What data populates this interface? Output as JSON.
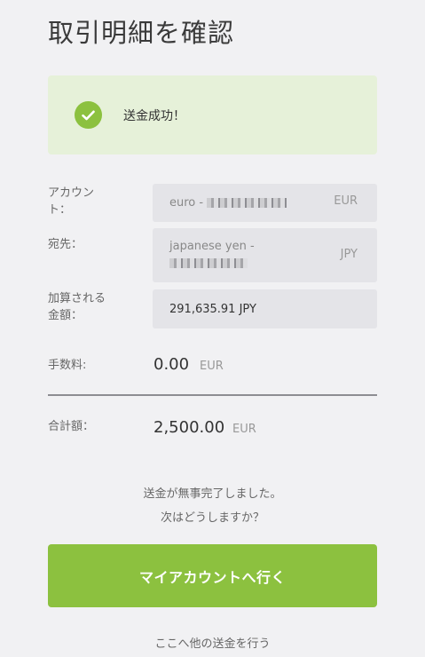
{
  "page": {
    "title": "取引明細を確認"
  },
  "banner": {
    "message": "送金成功！",
    "color": "#8cc13f",
    "background": "#e6f1d9"
  },
  "details": {
    "account_label_line1": "アカウン",
    "account_label_line2": "ト：",
    "account_value": "euro -",
    "account_currency": "EUR",
    "recipient_label": "宛先：",
    "recipient_value": "japanese yen -",
    "recipient_currency": "JPY",
    "credited_label_line1": "加算される",
    "credited_label_line2": "金額：",
    "credited_value": "291,635.91 JPY",
    "fee_label": "手数料:",
    "fee_value": "0.00",
    "fee_currency": "EUR",
    "total_label": "合計額：",
    "total_value": "2,500.00",
    "total_currency": "EUR"
  },
  "next_steps": {
    "line1": "送金が無事完了しました。",
    "line2": "次はどうしますか？"
  },
  "actions": {
    "primary_label": "マイアカウントへ行く",
    "secondary_label": "ここへ他の送金を行う"
  },
  "icons": {
    "check": "check-icon"
  }
}
